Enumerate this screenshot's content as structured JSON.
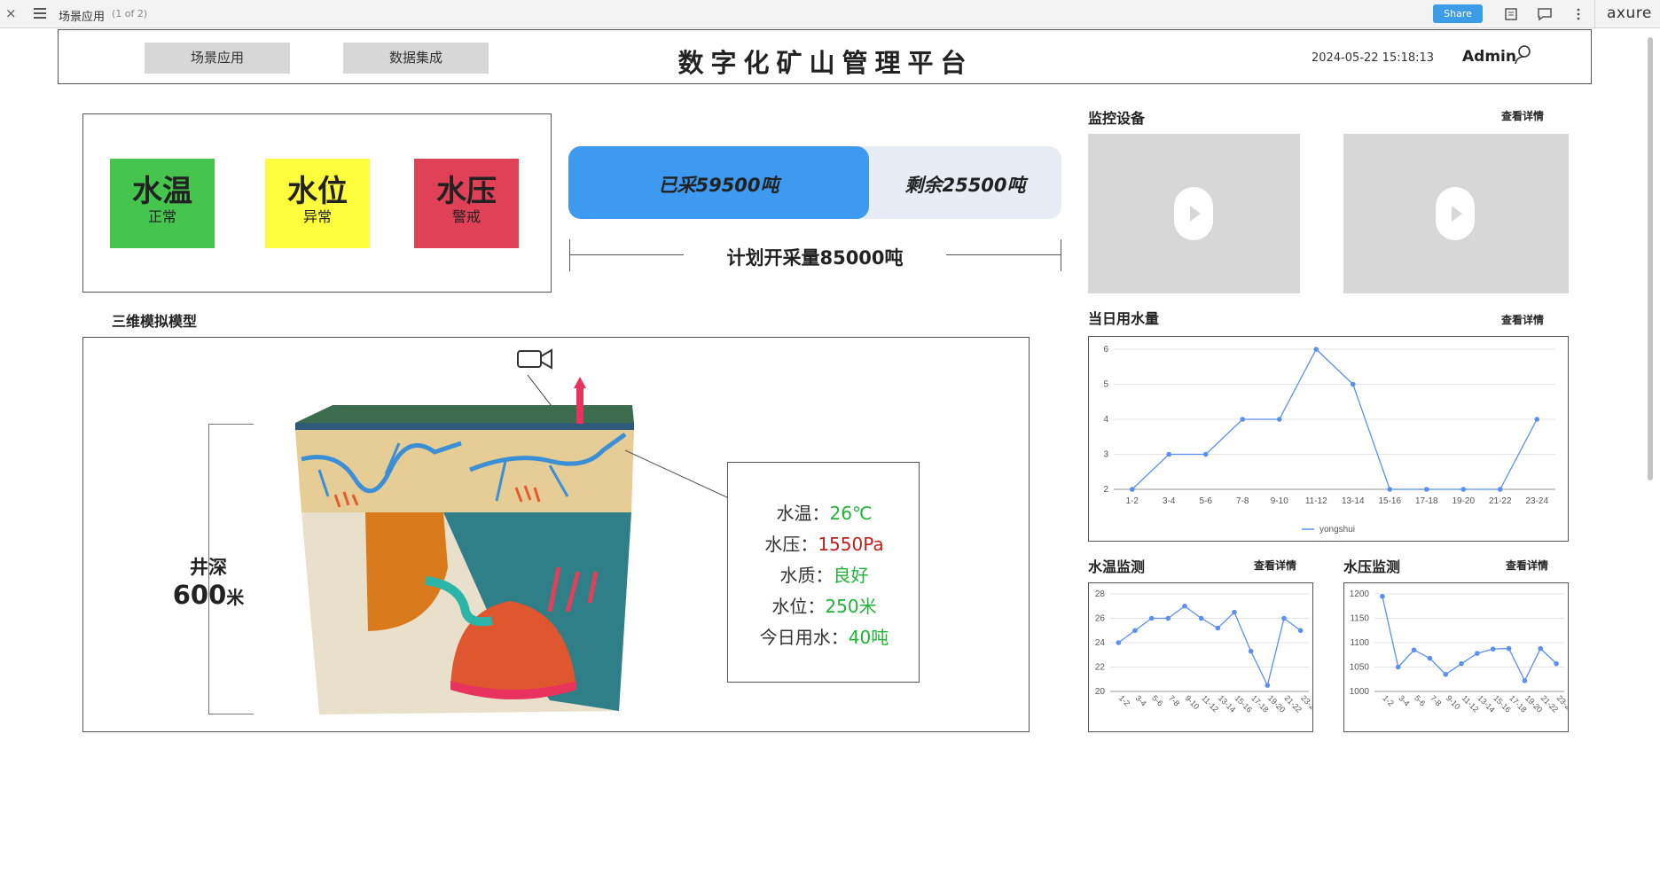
{
  "topbar": {
    "close": "×",
    "page_name": "场景应用",
    "page_count": "(1 of 2)",
    "share": "Share",
    "brand": "axure"
  },
  "header": {
    "nav": [
      "场景应用",
      "数据集成"
    ],
    "title": "数字化矿山管理平台",
    "datetime": "2024-05-22 15:18:13",
    "user": "Admin"
  },
  "status": [
    {
      "label": "水温",
      "state": "正常",
      "color": "#45c54e"
    },
    {
      "label": "水位",
      "state": "异常",
      "color": "#fdfd3e"
    },
    {
      "label": "水压",
      "state": "警戒",
      "color": "#e04157"
    }
  ],
  "production": {
    "mined_label": "已采59500吨",
    "remain_label": "剩余25500吨",
    "plan_label": "计划开采量85000吨",
    "mined_fraction": 0.7
  },
  "model": {
    "title": "三维模拟模型",
    "depth_label": "井深",
    "depth_value": "600",
    "depth_unit": "米",
    "info": [
      {
        "key": "水温：",
        "value": "26℃",
        "status": "ok"
      },
      {
        "key": "水压：",
        "value": "1550Pa",
        "status": "alert"
      },
      {
        "key": "水质：",
        "value": "良好",
        "status": "ok"
      },
      {
        "key": "水位：",
        "value": "250米",
        "status": "ok"
      },
      {
        "key": "今日用水：",
        "value": "40吨",
        "status": "ok"
      }
    ]
  },
  "monitor": {
    "title": "监控设备",
    "detail": "查看详情"
  },
  "water_usage": {
    "title": "当日用水量",
    "detail": "查看详情"
  },
  "water_temp": {
    "title": "水温监测",
    "detail": "查看详情"
  },
  "water_pressure": {
    "title": "水压监测",
    "detail": "查看详情"
  },
  "chart_data": [
    {
      "type": "line",
      "categories": [
        "1-2",
        "3-4",
        "5-6",
        "7-8",
        "9-10",
        "11-12",
        "13-14",
        "15-16",
        "17-18",
        "19-20",
        "21-22",
        "23-24"
      ],
      "series": [
        {
          "name": "yongshui",
          "values": [
            2,
            3,
            3,
            4,
            4,
            6,
            5,
            2,
            2,
            2,
            2,
            4
          ]
        }
      ],
      "ylim": [
        2,
        6
      ],
      "yticks": [
        2,
        3,
        4,
        5,
        6
      ],
      "color": "#5b8ff0"
    },
    {
      "type": "line",
      "categories": [
        "1-2",
        "3-4",
        "5-6",
        "7-8",
        "9-10",
        "11-12",
        "13-14",
        "15-16",
        "17-18",
        "19-20",
        "21-22",
        "23-24"
      ],
      "series": [
        {
          "values": [
            24,
            25,
            26,
            26,
            27,
            26,
            25.2,
            26.5,
            23.3,
            20.5,
            26,
            25
          ]
        }
      ],
      "ylim": [
        20,
        28
      ],
      "yticks": [
        20,
        22,
        24,
        26,
        28
      ],
      "color": "#5b8ff0"
    },
    {
      "type": "line",
      "categories": [
        "1-2",
        "3-4",
        "5-6",
        "7-8",
        "9-10",
        "11-12",
        "13-14",
        "15-16",
        "17-18",
        "19-20",
        "21-22",
        "23-24"
      ],
      "series": [
        {
          "values": [
            1195,
            1050,
            1085,
            1068,
            1035,
            1057,
            1078,
            1087,
            1088,
            1022,
            1088,
            1057
          ]
        }
      ],
      "ylim": [
        1000,
        1200
      ],
      "yticks": [
        1000,
        1050,
        1100,
        1150,
        1200
      ],
      "color": "#5b8ff0"
    }
  ]
}
